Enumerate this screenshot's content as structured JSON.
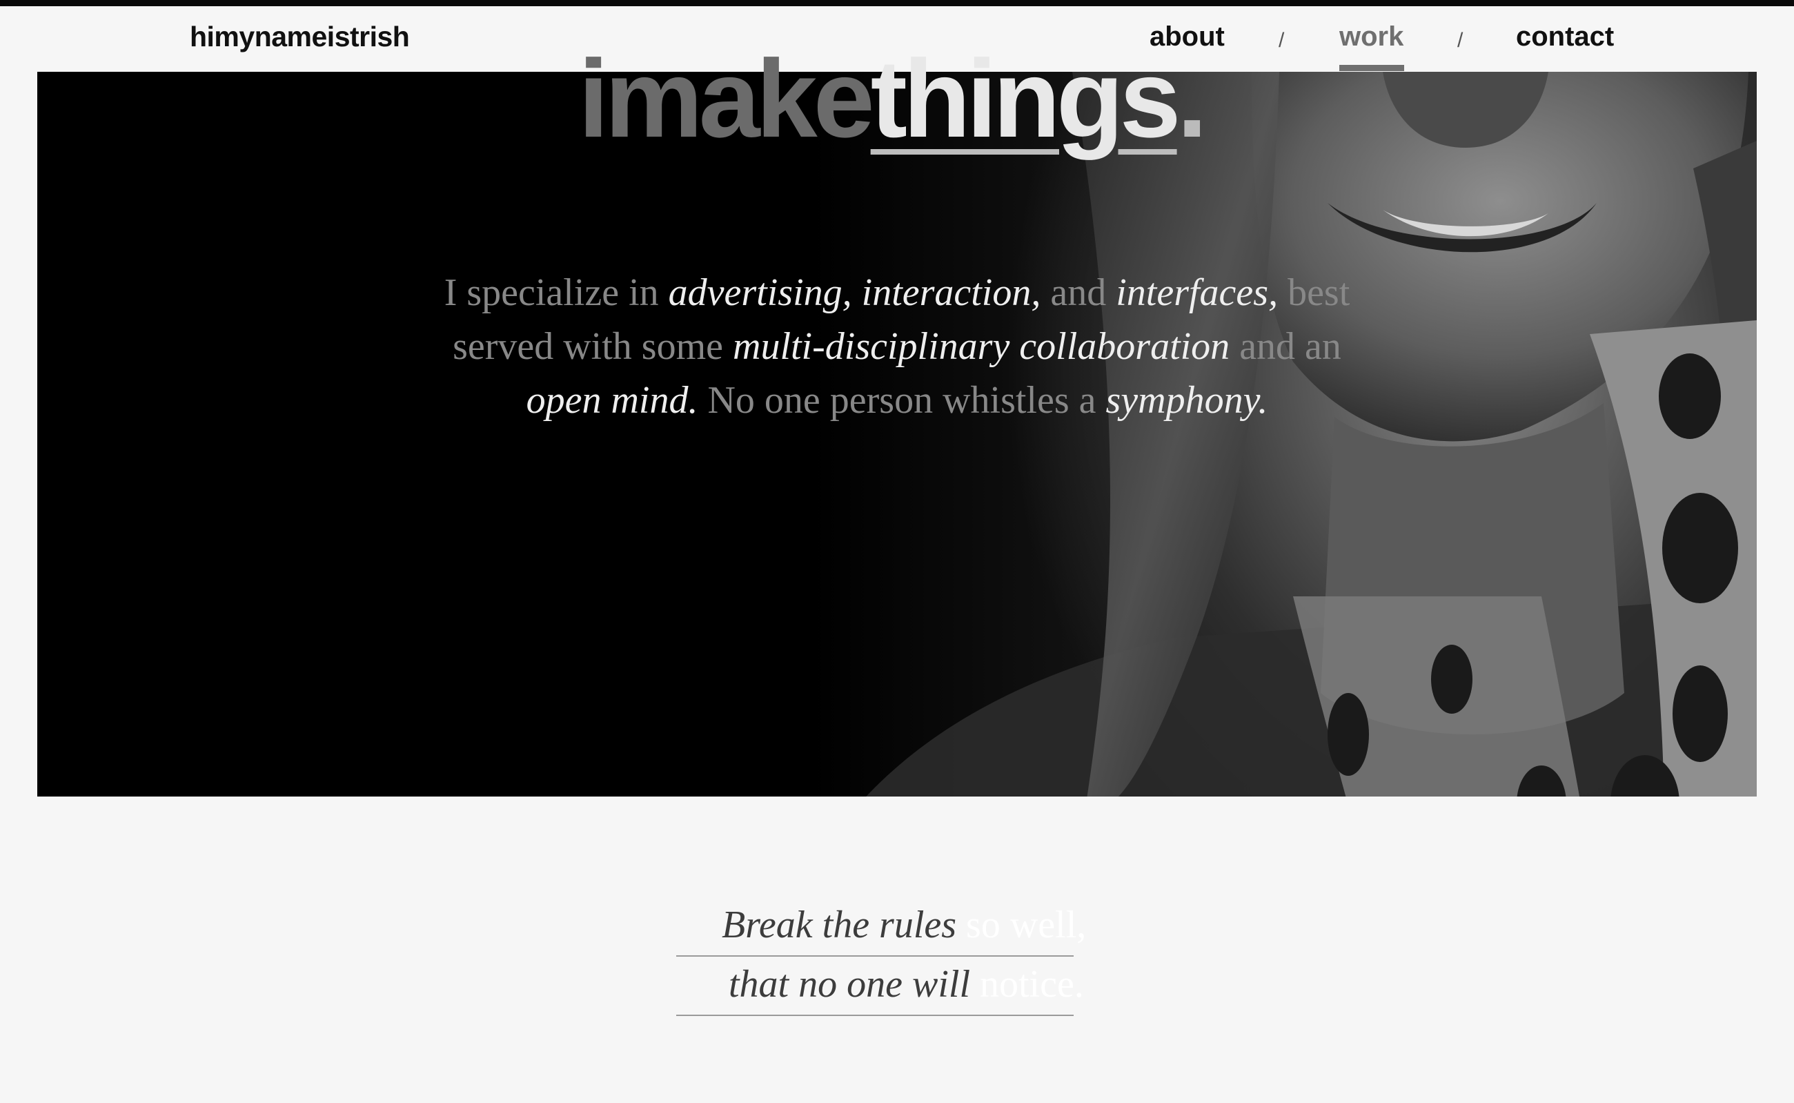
{
  "header": {
    "brand": "himynameistrish",
    "nav": {
      "about": "about",
      "work": "work",
      "contact": "contact",
      "separator": "/"
    },
    "active_nav": "work"
  },
  "hero": {
    "headline_light": "imake",
    "headline_bold": "things",
    "headline_dot": ".",
    "intro": {
      "p1": "I specialize in ",
      "e1": "advertising, interaction,",
      "p2": " and ",
      "e2": "interfaces,",
      "p3": " best served with some ",
      "e3": "multi-disciplinary collaboration",
      "p4": " and an ",
      "e4": "open mind.",
      "p5": " No one person whistles a ",
      "e5": "symphony."
    }
  },
  "quote": {
    "l1_italic": "Break the rules",
    "l1_plain": " so well,",
    "l2_italic": "that no one will",
    "l2_plain": " notice."
  },
  "colors": {
    "accent": "#6f6f6f",
    "dark": "#000000",
    "light": "#f6f6f6"
  }
}
